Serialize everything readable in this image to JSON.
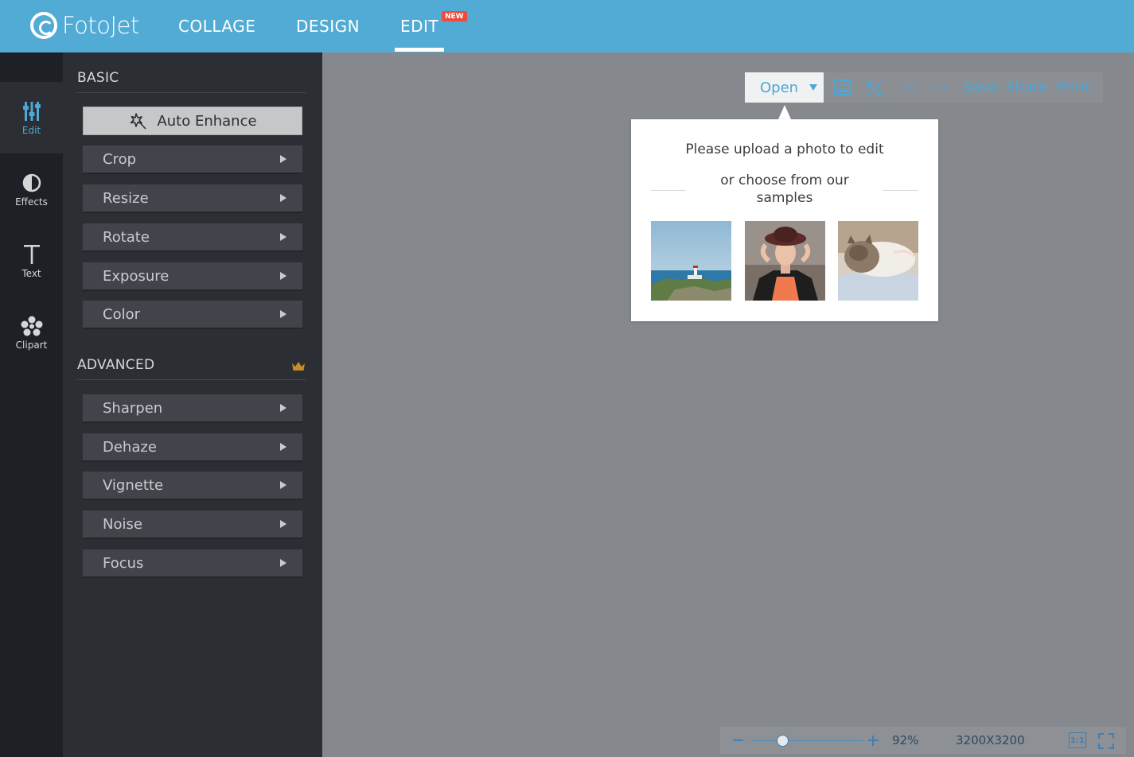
{
  "header": {
    "logo_text": "FotoJet",
    "nav": [
      {
        "label": "COLLAGE"
      },
      {
        "label": "DESIGN"
      },
      {
        "label": "EDIT",
        "badge": "NEW",
        "active": true
      }
    ]
  },
  "rail": [
    {
      "label": "Edit",
      "icon": "sliders-icon",
      "active": true
    },
    {
      "label": "Effects",
      "icon": "half-circle-icon"
    },
    {
      "label": "Text",
      "icon": "text-t-icon"
    },
    {
      "label": "Clipart",
      "icon": "clipart-flower-icon"
    }
  ],
  "panel": {
    "basic_title": "BASIC",
    "auto_enhance_label": "Auto Enhance",
    "basic_items": [
      "Crop",
      "Resize",
      "Rotate",
      "Exposure",
      "Color"
    ],
    "advanced_title": "ADVANCED",
    "advanced_items": [
      "Sharpen",
      "Dehaze",
      "Vignette",
      "Noise",
      "Focus"
    ]
  },
  "toolbar": {
    "open_label": "Open",
    "save_label": "Save",
    "share_label": "Share",
    "print_label": "Print"
  },
  "popover": {
    "title": "Please upload a photo to edit",
    "subtitle": "or choose from our samples",
    "samples": [
      "lighthouse-sample",
      "woman-hat-sample",
      "cat-sample"
    ]
  },
  "zoombar": {
    "zoom_value": "92%",
    "dimensions": "3200X3200",
    "actual_size_label": "1:1"
  },
  "colors": {
    "header_bg": "#52abd5",
    "accent": "#4ea7d6",
    "new_badge": "#ef4b3c",
    "panel_bg": "#2b2e33",
    "canvas_bg": "#85888c"
  }
}
